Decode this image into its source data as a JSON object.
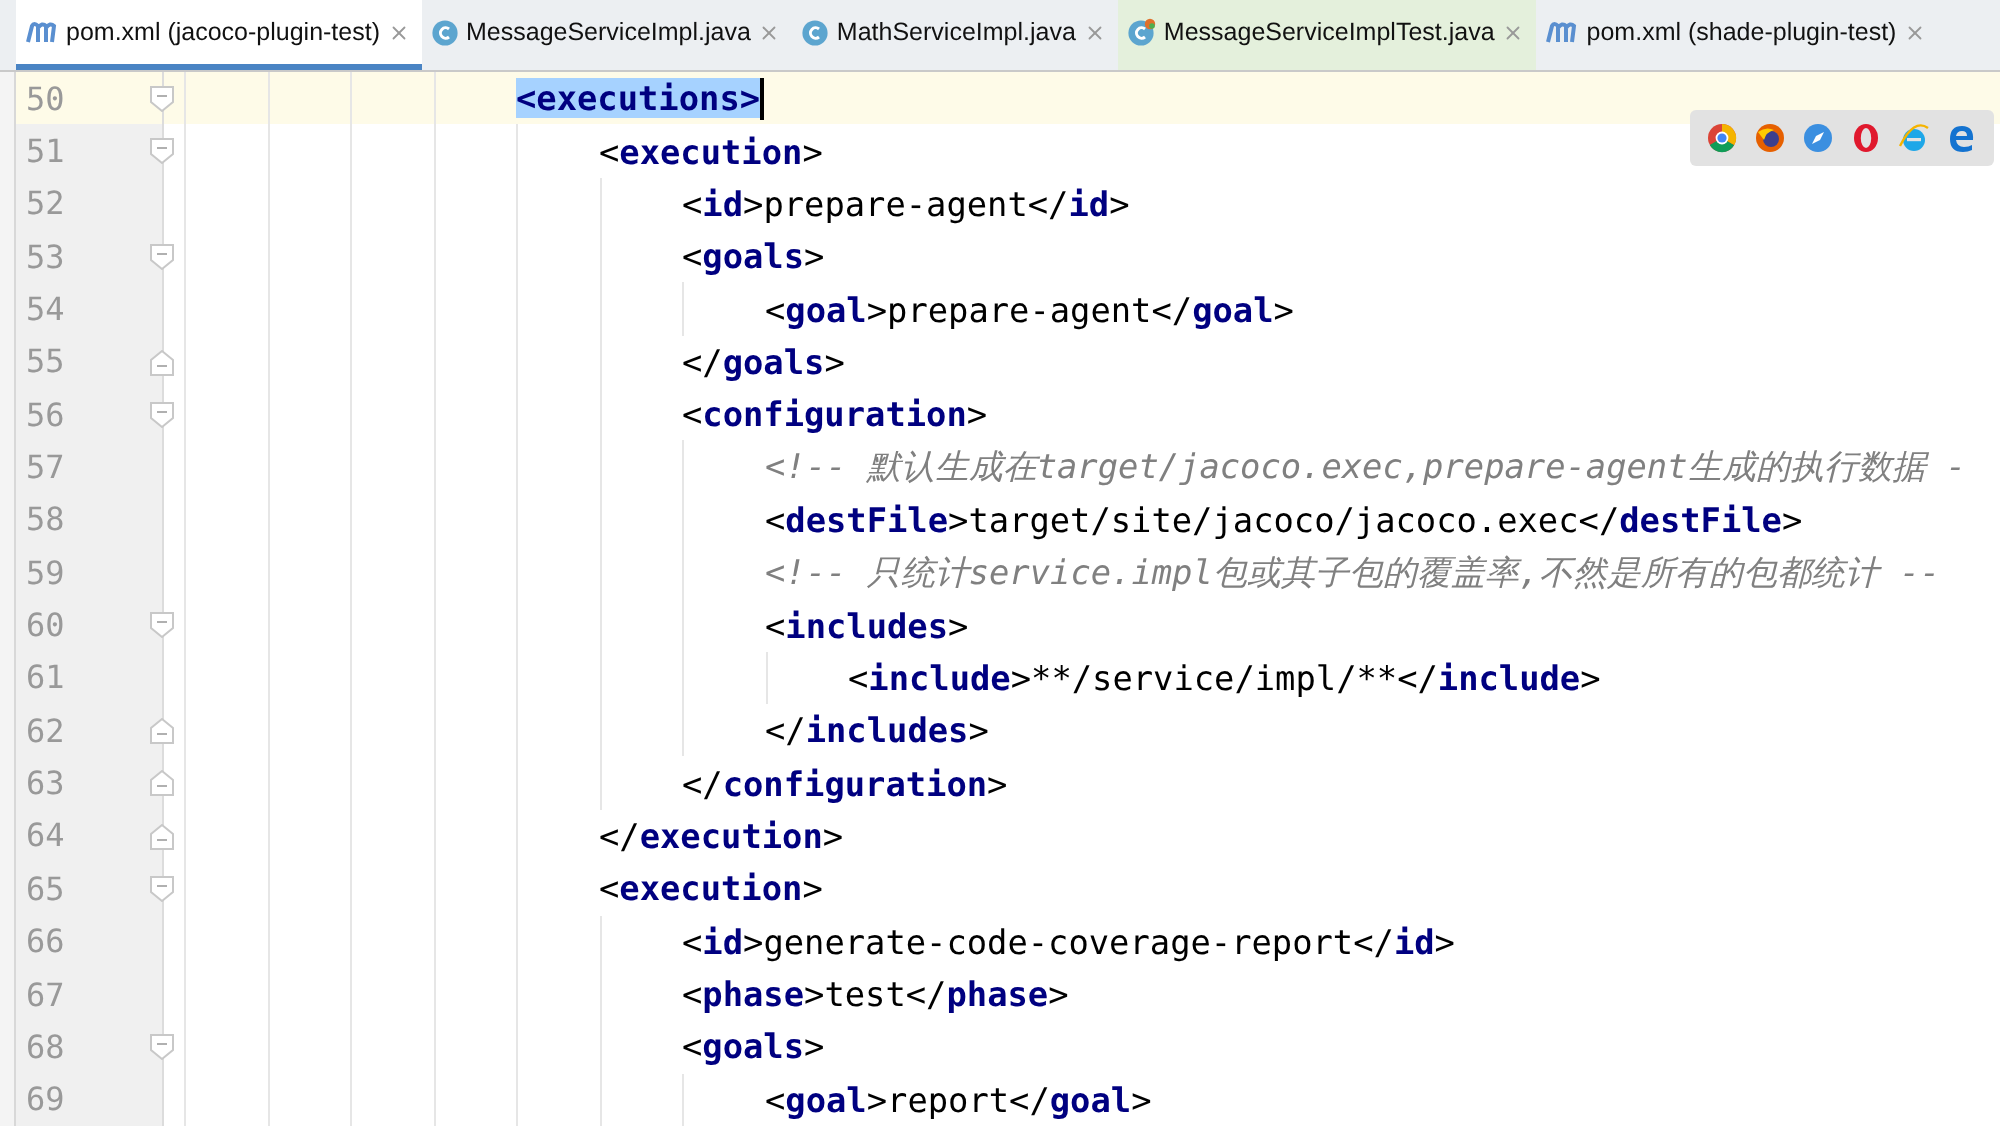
{
  "tabs": [
    {
      "label": "pom.xml (jacoco-plugin-test)",
      "kind": "maven",
      "selected": true
    },
    {
      "label": "MessageServiceImpl.java",
      "kind": "class",
      "selected": false
    },
    {
      "label": "MathServiceImpl.java",
      "kind": "class",
      "selected": false
    },
    {
      "label": "MessageServiceImplTest.java",
      "kind": "test",
      "selected": false
    },
    {
      "label": "pom.xml (shade-plugin-test)",
      "kind": "maven",
      "selected": false
    }
  ],
  "lines": [
    {
      "number": "50",
      "kind": "open",
      "current": true,
      "segments": [
        {
          "kind": "selected",
          "text": "<executions>"
        }
      ],
      "children": [
        {
          "number": "51",
          "kind": "open",
          "current": false,
          "segments": [
            {
              "kind": "bracket",
              "text": "<"
            },
            {
              "kind": "tag",
              "text": "execution"
            },
            {
              "kind": "bracket",
              "text": ">"
            }
          ],
          "children": [
            {
              "number": "52",
              "current": false,
              "segments": [
                {
                  "kind": "bracket",
                  "text": "<"
                },
                {
                  "kind": "tag",
                  "text": "id"
                },
                {
                  "kind": "bracket",
                  "text": ">"
                },
                {
                  "kind": "text",
                  "text": "prepare-agent"
                },
                {
                  "kind": "bracket",
                  "text": "</"
                },
                {
                  "kind": "tag",
                  "text": "id"
                },
                {
                  "kind": "bracket",
                  "text": ">"
                }
              ]
            },
            {
              "number": "53",
              "kind": "open",
              "current": false,
              "segments": [
                {
                  "kind": "bracket",
                  "text": "<"
                },
                {
                  "kind": "tag",
                  "text": "goals"
                },
                {
                  "kind": "bracket",
                  "text": ">"
                }
              ],
              "children": [
                {
                  "number": "54",
                  "current": false,
                  "segments": [
                    {
                      "kind": "bracket",
                      "text": "<"
                    },
                    {
                      "kind": "tag",
                      "text": "goal"
                    },
                    {
                      "kind": "bracket",
                      "text": ">"
                    },
                    {
                      "kind": "text",
                      "text": "prepare-agent"
                    },
                    {
                      "kind": "bracket",
                      "text": "</"
                    },
                    {
                      "kind": "tag",
                      "text": "goal"
                    },
                    {
                      "kind": "bracket",
                      "text": ">"
                    }
                  ]
                }
              ]
            },
            {
              "number": "55",
              "kind": "close",
              "current": false,
              "segments": [
                {
                  "kind": "bracket",
                  "text": "</"
                },
                {
                  "kind": "tag",
                  "text": "goals"
                },
                {
                  "kind": "bracket",
                  "text": ">"
                }
              ]
            },
            {
              "number": "56",
              "kind": "open",
              "current": false,
              "segments": [
                {
                  "kind": "bracket",
                  "text": "<"
                },
                {
                  "kind": "tag",
                  "text": "configuration"
                },
                {
                  "kind": "bracket",
                  "text": ">"
                }
              ],
              "children": [
                {
                  "number": "57",
                  "current": false,
                  "segments": [
                    {
                      "kind": "comment",
                      "text": "<!-- 默认生成在target/jacoco.exec,prepare-agent生成的执行数据 -"
                    }
                  ]
                },
                {
                  "number": "58",
                  "current": false,
                  "segments": [
                    {
                      "kind": "bracket",
                      "text": "<"
                    },
                    {
                      "kind": "tag",
                      "text": "destFile"
                    },
                    {
                      "kind": "bracket",
                      "text": ">"
                    },
                    {
                      "kind": "text",
                      "text": "target/site/jacoco/jacoco.exec"
                    },
                    {
                      "kind": "bracket",
                      "text": "</"
                    },
                    {
                      "kind": "tag",
                      "text": "destFile"
                    },
                    {
                      "kind": "bracket",
                      "text": ">"
                    }
                  ]
                },
                {
                  "number": "59",
                  "current": false,
                  "segments": [
                    {
                      "kind": "comment",
                      "text": "<!-- 只统计service.impl包或其子包的覆盖率,不然是所有的包都统计 --"
                    }
                  ]
                },
                {
                  "number": "60",
                  "kind": "open",
                  "current": false,
                  "segments": [
                    {
                      "kind": "bracket",
                      "text": "<"
                    },
                    {
                      "kind": "tag",
                      "text": "includes"
                    },
                    {
                      "kind": "bracket",
                      "text": ">"
                    }
                  ],
                  "children": [
                    {
                      "number": "61",
                      "current": false,
                      "segments": [
                        {
                          "kind": "bracket",
                          "text": "<"
                        },
                        {
                          "kind": "tag",
                          "text": "include"
                        },
                        {
                          "kind": "bracket",
                          "text": ">"
                        },
                        {
                          "kind": "text",
                          "text": "**/service/impl/**"
                        },
                        {
                          "kind": "bracket",
                          "text": "</"
                        },
                        {
                          "kind": "tag",
                          "text": "include"
                        },
                        {
                          "kind": "bracket",
                          "text": ">"
                        }
                      ]
                    }
                  ]
                },
                {
                  "number": "62",
                  "kind": "close",
                  "current": false,
                  "segments": [
                    {
                      "kind": "bracket",
                      "text": "</"
                    },
                    {
                      "kind": "tag",
                      "text": "includes"
                    },
                    {
                      "kind": "bracket",
                      "text": ">"
                    }
                  ]
                }
              ]
            },
            {
              "number": "63",
              "kind": "close",
              "current": false,
              "segments": [
                {
                  "kind": "bracket",
                  "text": "</"
                },
                {
                  "kind": "tag",
                  "text": "configuration"
                },
                {
                  "kind": "bracket",
                  "text": ">"
                }
              ]
            }
          ]
        },
        {
          "number": "64",
          "kind": "close",
          "current": false,
          "segments": [
            {
              "kind": "bracket",
              "text": "</"
            },
            {
              "kind": "tag",
              "text": "execution"
            },
            {
              "kind": "bracket",
              "text": ">"
            }
          ]
        },
        {
          "number": "65",
          "kind": "open",
          "current": false,
          "segments": [
            {
              "kind": "bracket",
              "text": "<"
            },
            {
              "kind": "tag",
              "text": "execution"
            },
            {
              "kind": "bracket",
              "text": ">"
            }
          ],
          "children": [
            {
              "number": "66",
              "current": false,
              "segments": [
                {
                  "kind": "bracket",
                  "text": "<"
                },
                {
                  "kind": "tag",
                  "text": "id"
                },
                {
                  "kind": "bracket",
                  "text": ">"
                },
                {
                  "kind": "text",
                  "text": "generate-code-coverage-report"
                },
                {
                  "kind": "bracket",
                  "text": "</"
                },
                {
                  "kind": "tag",
                  "text": "id"
                },
                {
                  "kind": "bracket",
                  "text": ">"
                }
              ]
            },
            {
              "number": "67",
              "current": false,
              "segments": [
                {
                  "kind": "bracket",
                  "text": "<"
                },
                {
                  "kind": "tag",
                  "text": "phase"
                },
                {
                  "kind": "bracket",
                  "text": ">"
                },
                {
                  "kind": "text",
                  "text": "test"
                },
                {
                  "kind": "bracket",
                  "text": "</"
                },
                {
                  "kind": "tag",
                  "text": "phase"
                },
                {
                  "kind": "bracket",
                  "text": ">"
                }
              ]
            },
            {
              "number": "68",
              "kind": "open",
              "current": false,
              "segments": [
                {
                  "kind": "bracket",
                  "text": "<"
                },
                {
                  "kind": "tag",
                  "text": "goals"
                },
                {
                  "kind": "bracket",
                  "text": ">"
                }
              ],
              "children": [
                {
                  "number": "69",
                  "current": false,
                  "segments": [
                    {
                      "kind": "bracket",
                      "text": "<"
                    },
                    {
                      "kind": "tag",
                      "text": "goal"
                    },
                    {
                      "kind": "bracket",
                      "text": ">"
                    },
                    {
                      "kind": "text",
                      "text": "report"
                    },
                    {
                      "kind": "bracket",
                      "text": "</"
                    },
                    {
                      "kind": "tag",
                      "text": "goal"
                    },
                    {
                      "kind": "bracket",
                      "text": ">"
                    }
                  ]
                }
              ]
            }
          ]
        }
      ]
    }
  ],
  "browsers": [
    {
      "kind": "chrome"
    },
    {
      "kind": "firefox"
    },
    {
      "kind": "safari"
    },
    {
      "kind": "opera"
    },
    {
      "kind": "ie"
    },
    {
      "kind": "edge"
    }
  ]
}
